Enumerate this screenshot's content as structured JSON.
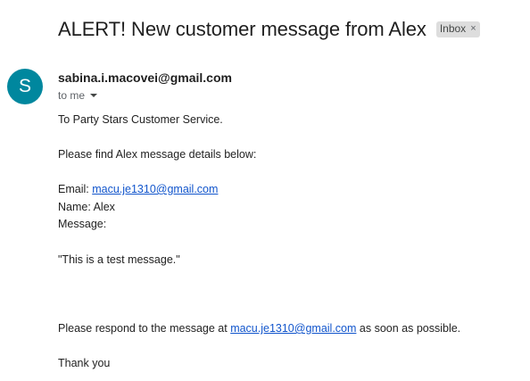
{
  "header": {
    "subject": "ALERT! New customer message from Alex",
    "label": "Inbox",
    "label_close": "×"
  },
  "sender": {
    "avatar_letter": "S",
    "email": "sabina.i.macovei@gmail.com",
    "to_text": "to me"
  },
  "message": {
    "greeting": "To Party Stars Customer Service.",
    "intro": "Please find Alex message details below:",
    "email_label": "Email: ",
    "email_value": "macu.je1310@gmail.com",
    "name_line": "Name: Alex",
    "message_label": "Message:",
    "quote": "\"This is a test message.\"",
    "respond_prefix": "Please respond to the message at ",
    "respond_email": "macu.je1310@gmail.com",
    "respond_suffix": " as soon as possible.",
    "closing": "Thank you"
  },
  "colors": {
    "avatar_bg": "#00879e",
    "link": "#1155cc",
    "label_bg": "#dddddd"
  }
}
